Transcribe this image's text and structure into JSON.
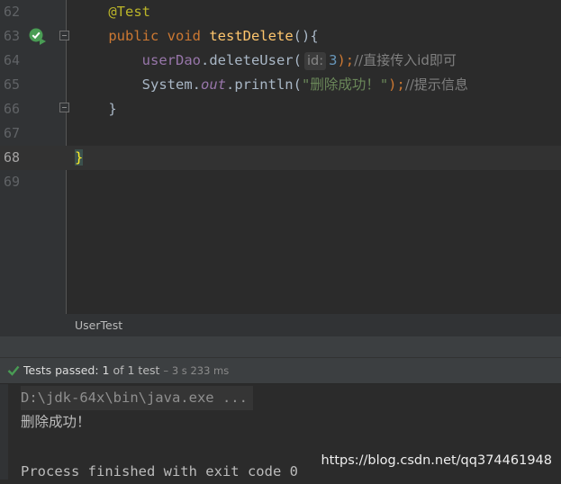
{
  "editor": {
    "lines": [
      {
        "number": "62",
        "annotation": "@Test"
      },
      {
        "number": "63",
        "kw1": "public",
        "kw2": "void",
        "method": "testDelete",
        "rest": "(){"
      },
      {
        "number": "64",
        "field": "userDao",
        "call": ".deleteUser(",
        "hint": "id:",
        "arg": "3",
        "close": ");",
        "comment": "//直接传入id即可"
      },
      {
        "number": "65",
        "cls": "System.",
        "field": "out",
        "call": ".println(",
        "string": "\"删除成功！\"",
        "close": ");",
        "comment": "//提示信息"
      },
      {
        "number": "66",
        "text": "}"
      },
      {
        "number": "67",
        "text": ""
      },
      {
        "number": "68",
        "text": "}"
      },
      {
        "number": "69",
        "text": ""
      }
    ],
    "current_line": "68",
    "run_icon": "run-test-icon"
  },
  "breadcrumb": {
    "label": "UserTest"
  },
  "status": {
    "icon": "check-icon",
    "prefix": "Tests passed:",
    "count": "1",
    "of": "of 1 test",
    "time": "– 3 s 233 ms",
    "accent": "#499c54"
  },
  "console": {
    "command": "D:\\jdk-64x\\bin\\java.exe ...",
    "output": "删除成功！",
    "exit": "Process finished with exit code 0"
  },
  "watermark": "https://blog.csdn.net/qq374461948"
}
